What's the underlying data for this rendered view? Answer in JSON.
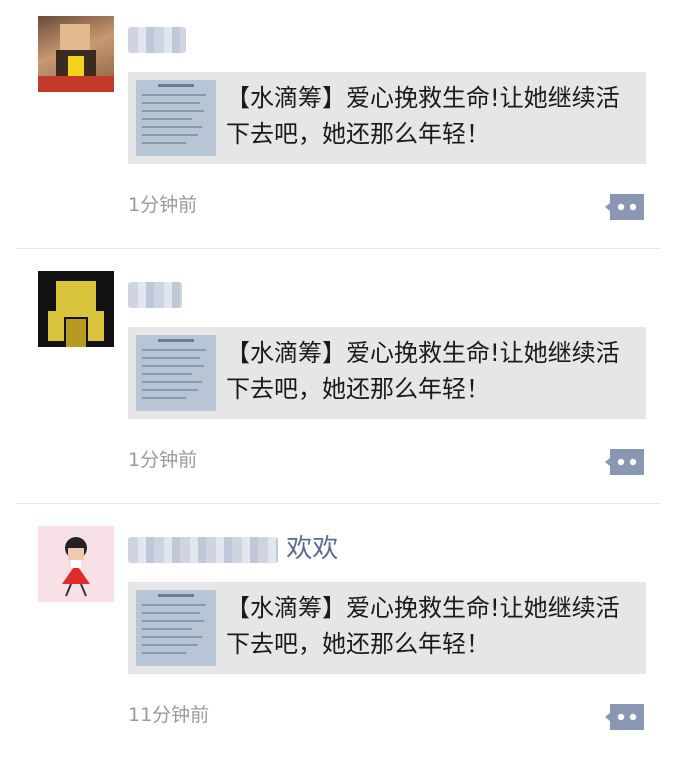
{
  "posts": [
    {
      "author": "",
      "card_text": "【水滴筹】爱心挽救生命!让她继续活下去吧，她还那么年轻！",
      "time": "1分钟前"
    },
    {
      "author": "",
      "card_text": "【水滴筹】爱心挽救生命!让她继续活下去吧，她还那么年轻！",
      "time": "1分钟前"
    },
    {
      "author": "欢欢",
      "card_text": "【水滴筹】爱心挽救生命!让她继续活下去吧，她还那么年轻！",
      "time": "11分钟前"
    }
  ],
  "colors": {
    "name": "#5b6b93",
    "card_bg": "#e6e6e6",
    "time": "#9a9a9a",
    "comment_icon": "#8a97b3"
  },
  "icons": {
    "comment": "comment-dots-icon",
    "link_thumbnail": "document-thumbnail-icon"
  }
}
